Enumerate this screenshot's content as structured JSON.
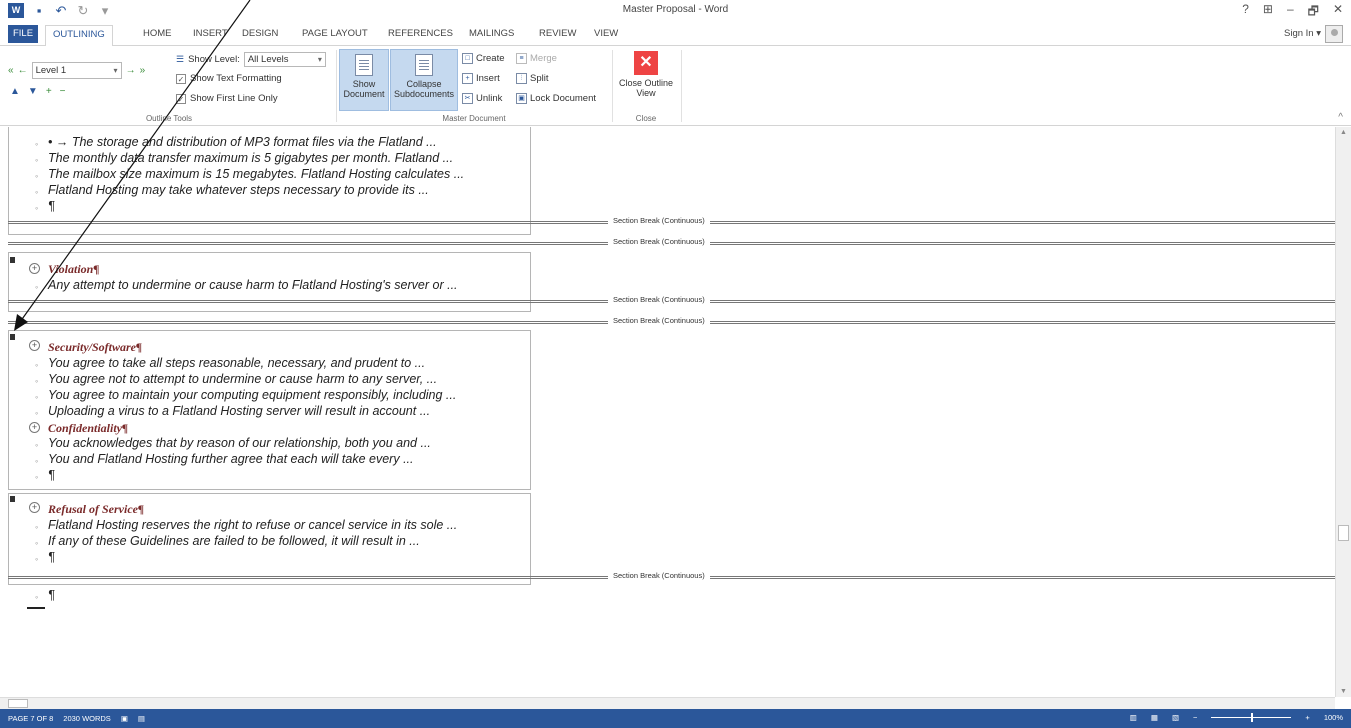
{
  "window": {
    "title": "Master Proposal - Word",
    "controls": [
      "?",
      "⊞",
      "–",
      "🗗",
      "✕"
    ]
  },
  "quick_access": [
    "word-logo",
    "save-icon",
    "undo-icon",
    "redo-icon",
    "customize-icon"
  ],
  "tabs": {
    "file": "FILE",
    "outlining": "OUTLINING",
    "home": "HOME",
    "insert": "INSERT",
    "design": "DESIGN",
    "page_layout": "PAGE LAYOUT",
    "references": "REFERENCES",
    "mailings": "MAILINGS",
    "review": "REVIEW",
    "view": "VIEW",
    "sign_in": "Sign In"
  },
  "ribbon": {
    "outline_tools": {
      "group_label": "Outline Tools",
      "level_value": "Level 1",
      "show_level_label": "Show Level:",
      "show_level_value": "All Levels",
      "show_text_formatting": "Show Text Formatting",
      "show_first_line_only": "Show First Line Only"
    },
    "master_document": {
      "group_label": "Master Document",
      "show_document": "Show Document",
      "collapse_subdocuments": "Collapse Subdocuments",
      "create": "Create",
      "merge": "Merge",
      "insert": "Insert",
      "split": "Split",
      "unlink": "Unlink",
      "lock_document": "Lock Document"
    },
    "close": {
      "group_label": "Close",
      "close_outline_view": "Close Outline View"
    }
  },
  "document": {
    "block1": [
      "The storage and distribution of MP3 format files via the Flatland ...",
      "The monthly data transfer maximum is 5 gigabytes per month. Flatland ...",
      "The mailbox size maximum is 15 megabytes. Flatland Hosting calculates ...",
      "Flatland Hosting may take whatever steps necessary to provide its ...",
      "¶"
    ],
    "section_break": "Section Break (Continuous)",
    "violation_heading": "Violation¶",
    "violation_lines": [
      "Any attempt to undermine or cause harm to Flatland Hosting's server or ..."
    ],
    "security_heading": "Security/Software¶",
    "security_lines": [
      "You agree to take all steps reasonable, necessary, and prudent to ...",
      "You agree not to attempt to undermine or cause harm to any server, ...",
      "You agree to maintain your computing equipment responsibly, including ...",
      "Uploading a virus to a Flatland Hosting server will result in account ..."
    ],
    "confidentiality_heading": "Confidentiality¶",
    "confidentiality_lines": [
      "You acknowledges that by reason of our relationship, both you and ...",
      "You and Flatland Hosting further agree that each will take every ...",
      "¶"
    ],
    "refusal_heading": "Refusal of Service¶",
    "refusal_lines": [
      "Flatland Hosting reserves the right to refuse or cancel service in its sole ...",
      "If any of these Guidelines are failed to be followed, it will result in ...",
      "¶"
    ],
    "final_line": "¶"
  },
  "status": {
    "page": "PAGE 7 OF 8",
    "words": "2030 WORDS",
    "zoom": "100%"
  },
  "colors": {
    "accent": "#2b579a",
    "heading": "#7a2a2a",
    "close_button": "#e44444"
  }
}
